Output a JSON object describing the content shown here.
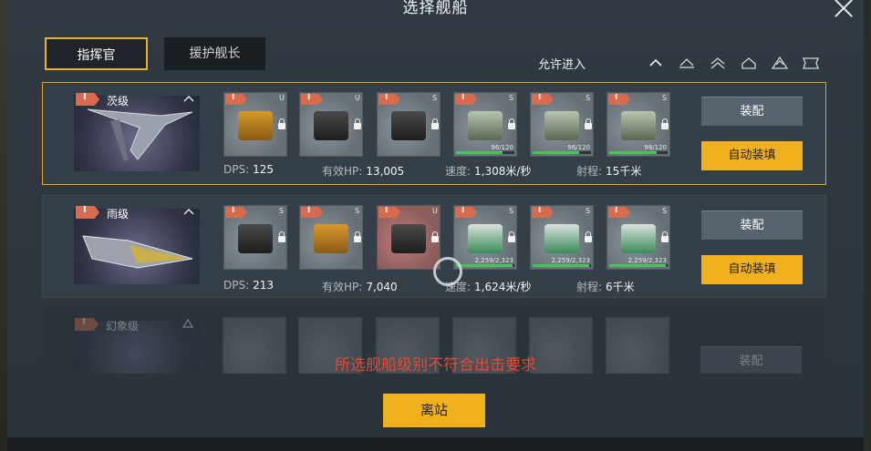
{
  "header": {
    "title": "选择舰船"
  },
  "tabs": [
    {
      "label": "指挥官"
    },
    {
      "label": "援护舰长"
    }
  ],
  "filter": {
    "label": "允许进入",
    "class_icons": [
      "chevron-up-icon",
      "triangle-icon",
      "double-chevron-icon",
      "dome-icon",
      "ring-triangle-icon",
      "banner-icon"
    ]
  },
  "ships": [
    {
      "rank": "I",
      "name": "茨级",
      "slots": [
        {
          "rank": "I",
          "size": "U",
          "type": "gold"
        },
        {
          "rank": "I",
          "size": "U",
          "type": "dark"
        },
        {
          "rank": "I",
          "size": "S",
          "type": "dark"
        },
        {
          "rank": "I",
          "size": "S",
          "type": "green",
          "ammo": "96/120",
          "fill": 0.8
        },
        {
          "rank": "I",
          "size": "S",
          "type": "green",
          "ammo": "96/120",
          "fill": 0.8
        },
        {
          "rank": "I",
          "size": "S",
          "type": "green",
          "ammo": "98/120",
          "fill": 0.82
        }
      ],
      "stats": {
        "dps_label": "DPS:",
        "dps": "125",
        "hp_label": "有效HP:",
        "hp": "13,005",
        "speed_label": "速度:",
        "speed": "1,308米/秒",
        "range_label": "射程:",
        "range": "15千米"
      },
      "equip_label": "装配",
      "auto_label": "自动装填"
    },
    {
      "rank": "I",
      "name": "雨级",
      "slots": [
        {
          "rank": "I",
          "size": "S",
          "type": "dark"
        },
        {
          "rank": "I",
          "size": "S",
          "type": "gold"
        },
        {
          "rank": "I",
          "size": "U",
          "type": "red"
        },
        {
          "rank": "I",
          "size": "S",
          "type": "teal",
          "ammo": "2,259/2,323",
          "fill": 0.97
        },
        {
          "rank": "I",
          "size": "S",
          "type": "teal",
          "ammo": "2,259/2,323",
          "fill": 0.97
        },
        {
          "rank": "I",
          "size": "S",
          "type": "teal",
          "ammo": "2,259/2,323",
          "fill": 0.97
        }
      ],
      "stats": {
        "dps_label": "DPS:",
        "dps": "213",
        "hp_label": "有效HP:",
        "hp": "7,040",
        "speed_label": "速度:",
        "speed": "1,624米/秒",
        "range_label": "射程:",
        "range": "6千米"
      },
      "equip_label": "装配",
      "auto_label": "自动装填"
    },
    {
      "rank": "I",
      "name": "幻象级",
      "equip_label": "装配"
    }
  ],
  "warning": "所选舰船级别不符合出击要求",
  "depart_label": "离站"
}
